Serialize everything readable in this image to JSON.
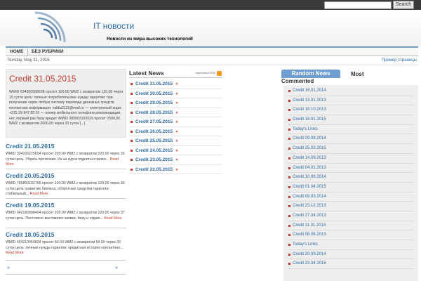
{
  "search": {
    "placeholder": "",
    "button_label": "Search"
  },
  "site": {
    "title": "IT новости",
    "tagline": "Новости из мира высоких технологий"
  },
  "nav": {
    "items": [
      "HOME",
      "БЕЗ РУБРИКИ"
    ]
  },
  "datebar": {
    "date": "Sunday, May 31, 2015",
    "example_link": "Пример страницы"
  },
  "featured": {
    "title": "Credit 31.05.2015",
    "text": "WMID 634300568608 просит 100,00 WMZ с возвратом 120,00 через 15 суток цель: личные потребительские нужды гарантии: при получении через любую систему перевода денежных средств контактная информация: valdis2111@mail.ru — электронный ящик +375 29 847 85 01 — номер мобильного телефона рекомендации: нет, первый раз беру кредит WMID 389903192029 просит 2500,00 WMZ с возвратом 2600,00 через 20 суток [...]"
  },
  "posts": [
    {
      "title": "Credit 21.05.2015",
      "text": "WMID 324106225604 просит 200.00 WMZ с возвратом 220.00 через 30 суток цель: Убрать претензии. Из-за курса подняться резко...",
      "more": "Read More"
    },
    {
      "title": "Credit 20.05.2015",
      "text": "WMID 785850102765 просит 100.00 WMZ с возвратом 120.00 через 30 суток цель: развитие бизнеса, оборотные средства гарантии: стабильный...",
      "more": "Read More"
    },
    {
      "title": "Credit 19.05.2015",
      "text": "WMID 342182898404 просит 200.00 WMZ с возвратом 220.00 через 37 суток цель: Постоянно выставляю заявки, беру и отдаю...",
      "more": "Read More"
    },
    {
      "title": "Credit 18.05.2015",
      "text": "WMID 464213454834 просит 50.00 WMZ с возвратом 54.00 через 30 суток цель: личные нужды гарантии: кредитная история контактная...",
      "more": "Read More"
    }
  ],
  "pager": {
    "prev": "»",
    "next": "»"
  },
  "latest": {
    "title": "Latest News",
    "rss_label": "подписаться RSS",
    "arrow": "»",
    "items": [
      "Credit 31.05.2015",
      "Credit 30.05.2015",
      "Credit 29.05.2015",
      "Credit 28.05.2015",
      "Credit 27.05.2015",
      "Credit 26.05.2015",
      "Credit 25.05.2015",
      "Credit 24.05.2015",
      "Credit 23.05.2015",
      "Credit 22.05.2015"
    ]
  },
  "tabs": {
    "random": "Random News",
    "commented_1": "Most",
    "commented_2": "Commented"
  },
  "random": {
    "items": [
      "Credit 16.01.2014",
      "Credit 13.01.2013",
      "Credit 18.10.2013",
      "Credit 18.01.2015",
      "Today's Links",
      "Credit 09.08.2014",
      "Credit 25.03.2015",
      "Credit 14.09.2013",
      "Credit 04.01.2013",
      "Credit 10.09.2014",
      "Credit 01.04.2015",
      "Credit 09.03.2014",
      "Credit 23.12.2013",
      "Credit 27.04.2013",
      "Credit 11.01.2014",
      "Credit 08.06.2013",
      "Today's Links",
      "Credit 20.09.2014",
      "Credit 23.04.2015"
    ]
  },
  "colors": {
    "accent": "#2c6aa4",
    "red": "#c0392b",
    "nav_border": "#6f9fd0"
  }
}
